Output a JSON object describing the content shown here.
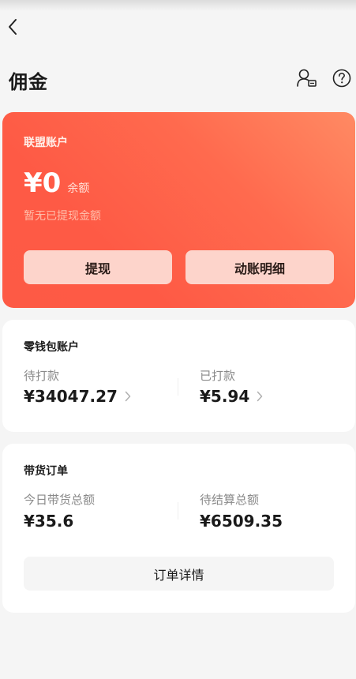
{
  "header": {
    "title": "佣金",
    "back_icon": "chevron-left-icon",
    "icons": [
      "user-account-icon",
      "help-circle-icon"
    ]
  },
  "alliance": {
    "title": "联盟账户",
    "amount": "¥0",
    "amount_unit": "余额",
    "subtext": "暂无已提现金额",
    "withdraw_label": "提现",
    "details_label": "动账明细",
    "accent_color": "#fd5a45"
  },
  "wallet": {
    "title": "零钱包账户",
    "pending_label": "待打款",
    "pending_value": "¥34047.27",
    "paid_label": "已打款",
    "paid_value": "¥5.94"
  },
  "orders": {
    "title": "带货订单",
    "today_label": "今日带货总额",
    "today_value": "¥35.6",
    "settle_label": "待结算总额",
    "settle_value": "¥6509.35",
    "details_label": "订单详情"
  }
}
